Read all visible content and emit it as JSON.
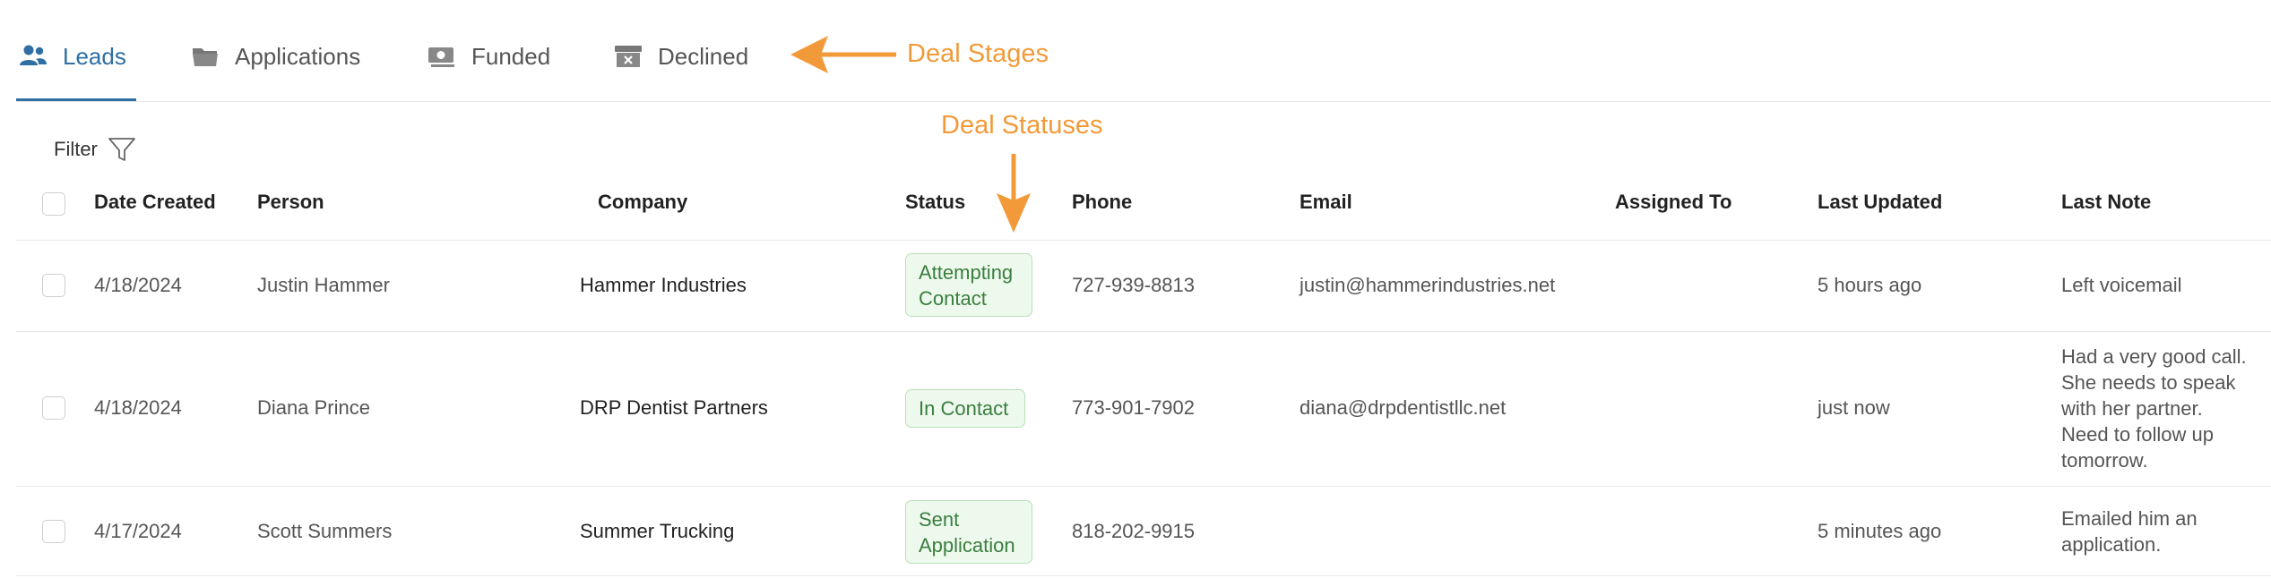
{
  "tabs": [
    {
      "label": "Leads",
      "icon": "users-icon",
      "active": true
    },
    {
      "label": "Applications",
      "icon": "folder-icon",
      "active": false
    },
    {
      "label": "Funded",
      "icon": "money-icon",
      "active": false
    },
    {
      "label": "Declined",
      "icon": "archive-x-icon",
      "active": false
    }
  ],
  "annotations": {
    "deal_stages": "Deal Stages",
    "deal_statuses": "Deal Statuses",
    "color": "#f29a3a"
  },
  "filter": {
    "label": "Filter",
    "icon": "filter-icon"
  },
  "table": {
    "headers": {
      "date_created": "Date Created",
      "person": "Person",
      "company": "Company",
      "status": "Status",
      "phone": "Phone",
      "email": "Email",
      "assigned_to": "Assigned To",
      "last_updated": "Last Updated",
      "last_note": "Last Note"
    },
    "rows": [
      {
        "date": "4/18/2024",
        "person": "Justin Hammer",
        "company": "Hammer Industries",
        "status_line1": "Attempting",
        "status_line2": "Contact",
        "phone": "727-939-8813",
        "email": "justin@hammerindustries.net",
        "assigned_to": "",
        "last_updated": "5 hours ago",
        "note_lines": [
          "Left voicemail"
        ]
      },
      {
        "date": "4/18/2024",
        "person": "Diana Prince",
        "company": "DRP Dentist Partners",
        "status_line1": "In Contact",
        "status_line2": "",
        "phone": "773-901-7902",
        "email": "diana@drpdentistllc.net",
        "assigned_to": "",
        "last_updated": "just now",
        "note_lines": [
          "Had a very good call.",
          "She needs to speak",
          "with her partner.",
          "Need to follow up",
          "tomorrow."
        ]
      },
      {
        "date": "4/17/2024",
        "person": "Scott Summers",
        "company": "Summer Trucking",
        "status_line1": "Sent",
        "status_line2": "Application",
        "phone": "818-202-9915",
        "email": "",
        "assigned_to": "",
        "last_updated": "5 minutes ago",
        "note_lines": [
          "Emailed him an",
          "application."
        ]
      }
    ]
  },
  "colors": {
    "accent": "#2f6fa3",
    "badge_green": "#3a7e3e",
    "annotation": "#f29a3a"
  }
}
